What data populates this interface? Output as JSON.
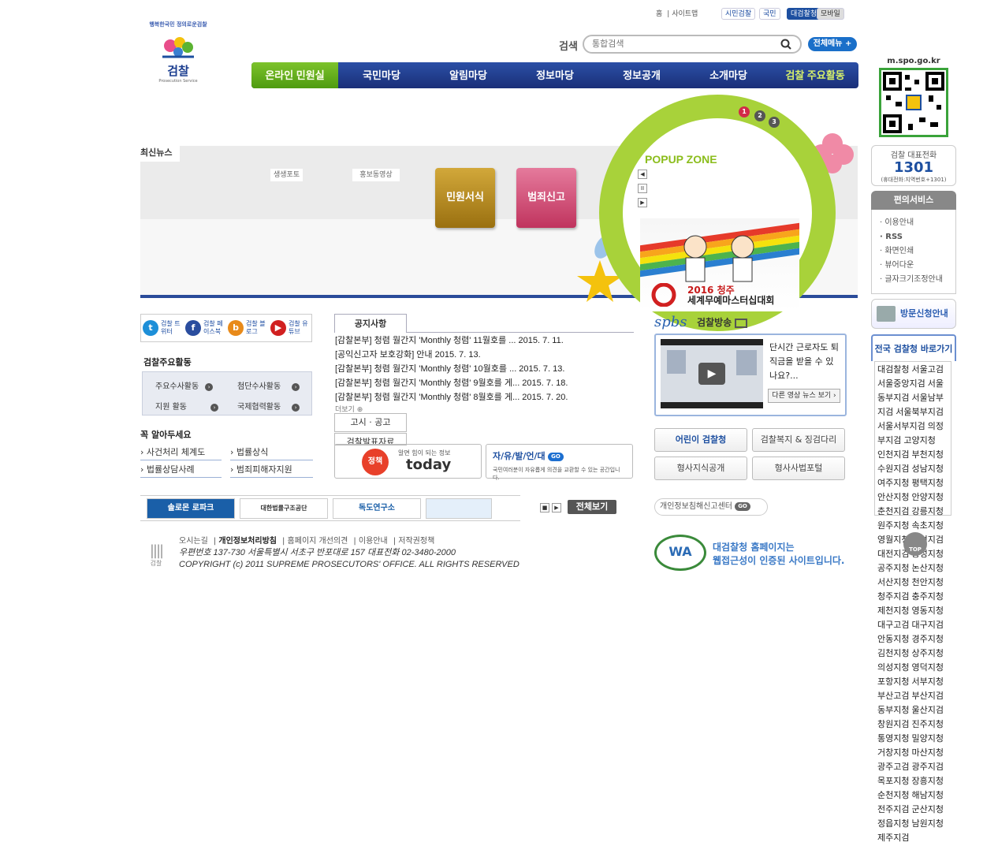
{
  "header": {
    "util_links": [
      "홈",
      "사이트맵"
    ],
    "btn_citizen": "시민검찰",
    "btn_nation": "국민",
    "btn_spo": "대검찰청",
    "btn_mobile": "모바일",
    "logo_slogan": "행복한국민 정의로운검찰",
    "logo_name": "검찰",
    "logo_sub": "Prosecution Service",
    "search_label": "검색",
    "search_placeholder": "통합검색",
    "all_menu": "전체메뉴"
  },
  "gnb": [
    "온라인 민원실",
    "국민마당",
    "알림마당",
    "정보마당",
    "정보공개",
    "소개마당",
    "검찰 주요활동"
  ],
  "visual": {
    "news_title": "최신뉴스",
    "tab1": "생생포토",
    "tab2": "홍보동영상",
    "btn1": "민원서식",
    "btn2": "범죄신고",
    "popup_title": "POPUP ZONE",
    "dots": [
      "1",
      "2",
      "3"
    ],
    "banner_line1": "2016 청주",
    "banner_line2": "세계무예마스터십대회"
  },
  "social": [
    {
      "label": "검찰 트위터",
      "icon": "twitter-icon",
      "letter": "t",
      "color": "#1d8fd8"
    },
    {
      "label": "검찰 페이스북",
      "icon": "facebook-icon",
      "letter": "f",
      "color": "#2a4d9e"
    },
    {
      "label": "검찰 블로그",
      "icon": "blog-icon",
      "letter": "b",
      "color": "#e88a1a"
    },
    {
      "label": "검찰 유튜브",
      "icon": "youtube-icon",
      "letter": "▶",
      "color": "#d12020"
    }
  ],
  "activities": {
    "title": "검찰주요활동",
    "items": [
      "주요수사활동",
      "첨단수사활동",
      "지원 활동",
      "국제협력활동"
    ]
  },
  "must_know": {
    "title": "꼭 알아두세요",
    "items": [
      "사건처리 체계도",
      "법률상식",
      "법률상담사례",
      "범죄피해자지원"
    ]
  },
  "notice": {
    "tab": "공지사항",
    "items": [
      "[감찰본부] 청렴 월간지 'Monthly 청렴' 11월호를 ... 2015. 7. 11.",
      "[공익신고자 보호강화] 안내 2015. 7. 13.",
      "[감찰본부] 청렴 월간지 'Monthly 청렴' 10월호를 ... 2015. 7. 13.",
      "[감찰본부] 청렴 월간지 'Monthly 청렴' 9월호를 게... 2015. 7. 18.",
      "[감찰본부] 청렴 월간지 'Monthly 청렴' 8월호를 게... 2015. 7. 20."
    ],
    "more": "더보기",
    "tab2": "고시 · 공고",
    "tab3": "검찰발표자료"
  },
  "today": {
    "tag": "정책",
    "caption": "알면 힘이 되는 정보",
    "title": "today"
  },
  "free": {
    "title": "자/유/발/언/대",
    "go": "GO",
    "desc": "국민여러분이 자유롭게 의견을 교환할 수 있는 공간입니다."
  },
  "spbs": {
    "logo": "spbs",
    "title": "검찰방송",
    "video_text": "단시간 근로자도 퇴직금을 받을 수 있나요?...",
    "more": "다른 영상 뉴스 보기"
  },
  "quick": [
    "어린이 검찰청",
    "검찰복지 & 징검다리",
    "형사지식공개",
    "형사사법포털"
  ],
  "privacy": {
    "label": "개인정보침해신고센터",
    "go": "GO"
  },
  "wa": {
    "mark": "WA",
    "line1": "대검찰청 홈페이지는",
    "line2": "웹접근성이 인증된 사이트입니다."
  },
  "partners": [
    "솔로몬 로파크",
    "대한법률구조공단",
    "독도연구소",
    ""
  ],
  "view_all": "전체보기",
  "footer": {
    "links": [
      "오시는길",
      "개인정보처리방침",
      "홈페이지 개선의견",
      "이용안내",
      "저작권정책"
    ],
    "address": "우편번호 137-730 서울특별시 서초구 반포대로 157  대표전화 02-3480-2000",
    "copyright": "COPYRIGHT (c) 2011 SUPREME PROSECUTORS' OFFICE. ALL RIGHTS RESERVED",
    "logo": "검찰"
  },
  "sidebar": {
    "qr_label": "m.spo.go.kr",
    "call_title": "검찰 대표전화",
    "call_number": "1301",
    "call_sub": "(휴대전화:지역번호+1301)",
    "conv_title": "편의서비스",
    "conv_items": [
      "이용안내",
      "RSS",
      "화면인쇄",
      "뷰어다운",
      "글자크기조정안내"
    ],
    "visit": "방문신청안내",
    "nat_title": "전국 검찰청 바로가기",
    "nat_lines": [
      "대검찰청 서울고검",
      "서울중앙지검 서울",
      "동부지검 서울남부",
      "지검 서울북부지검",
      "서울서부지검 의정",
      "부지검 고양지청",
      "인천지검 부천지청",
      "수원지검 성남지청",
      "여주지청 평택지청",
      "안산지청 안양지청",
      "춘천지검 강릉지청",
      "원주지청 속초지청",
      "영월지청 정선지검",
      "대전지검 홍성지청",
      "공주지청 논산지청",
      "서산지청 천안지청",
      "청주지검 충주지청",
      "제천지청 영동지청",
      "대구고검 대구지검",
      "안동지청 경주지청",
      "김천지청 상주지청",
      "의성지청 영덕지청",
      "포항지청 서부지청",
      "부산고검 부산지검",
      "동부지청 울산지검",
      "창원지검 진주지청",
      "통영지청 밀양지청",
      "거창지청 마산지청",
      "광주고검 광주지검",
      "목포지청 장흥지청",
      "순천지청 해남지청",
      "전주지검 군산지청",
      "정읍지청 남원지청",
      "제주지검"
    ],
    "top": "TOP"
  }
}
